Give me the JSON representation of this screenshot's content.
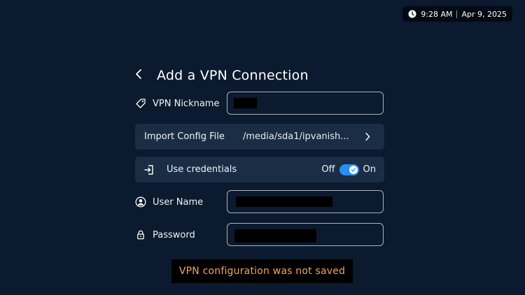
{
  "status_bar": {
    "time": "9:28 AM",
    "date": "Apr 9, 2025",
    "clock_icon": "clock-icon"
  },
  "header": {
    "back_icon": "chevron-left-icon",
    "title": "Add a VPN Connection"
  },
  "form": {
    "nickname": {
      "label": "VPN Nickname",
      "icon": "tag-icon",
      "value_redacted": true
    },
    "import_config": {
      "label": "Import Config File",
      "value": "/media/sda1/ipvanish...",
      "icon": "chevron-right-icon"
    },
    "use_credentials": {
      "label": "Use credentials",
      "icon": "sign-in-icon",
      "off_label": "Off",
      "on_label": "On",
      "state": "on"
    },
    "user_name": {
      "label": "User Name",
      "icon": "user-circle-icon",
      "value_redacted": true
    },
    "password": {
      "label": "Password",
      "icon": "lock-icon",
      "value_redacted": true
    }
  },
  "toast": {
    "message": "VPN configuration was not saved"
  },
  "colors": {
    "background": "#0b1a2e",
    "panel": "#1a2d44",
    "toggle_on": "#2a8df0",
    "toast_text": "#f2a55d"
  }
}
